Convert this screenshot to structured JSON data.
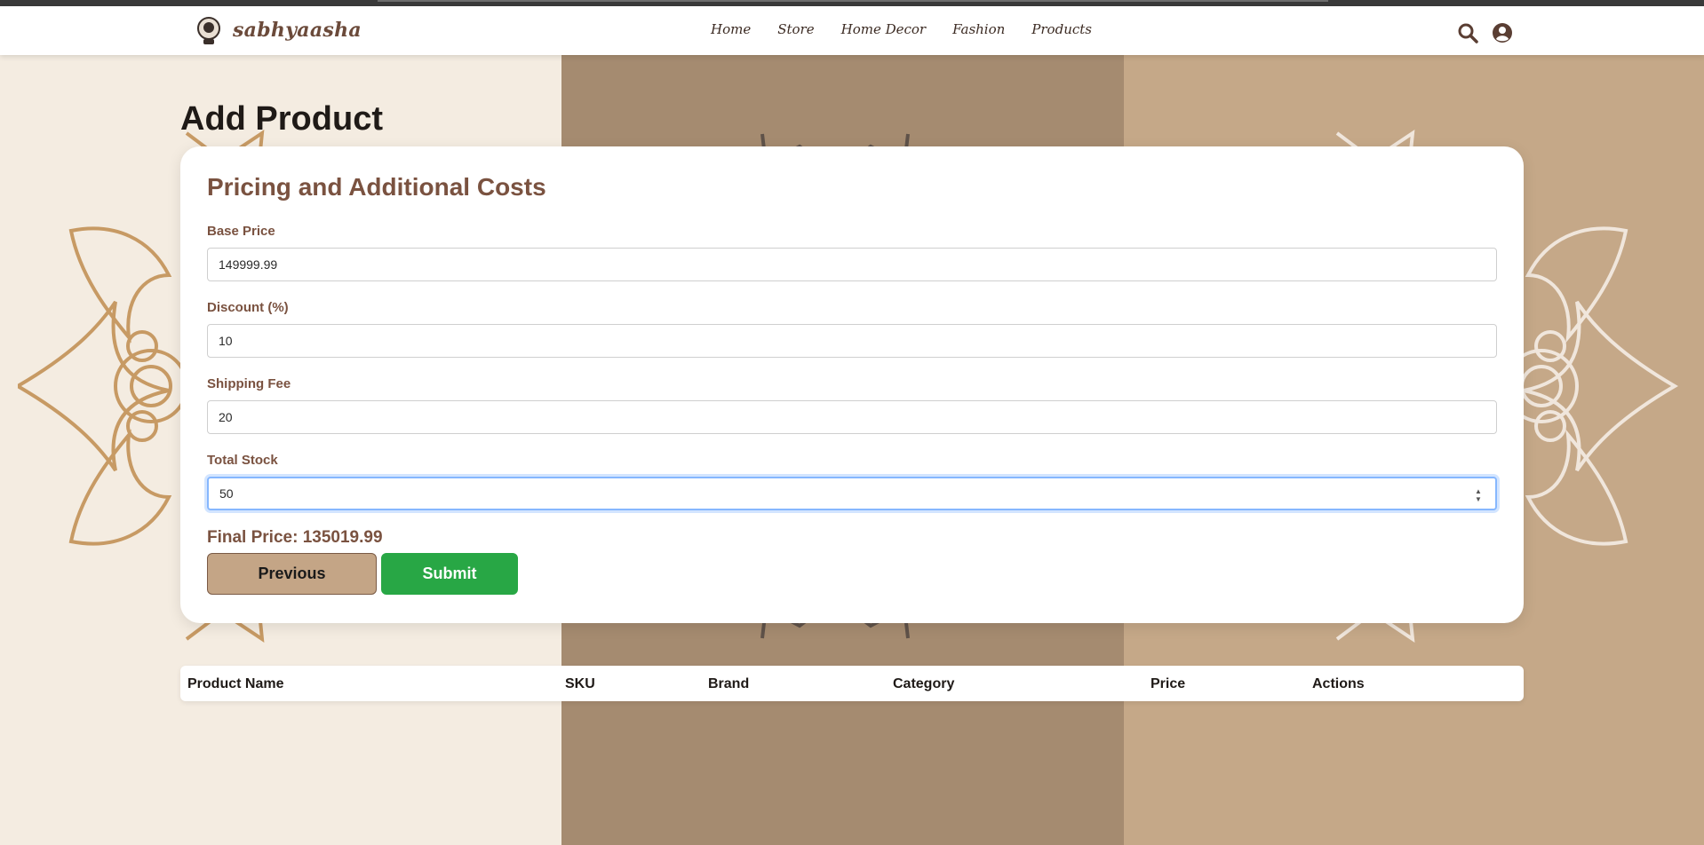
{
  "header": {
    "brand": "sabhyaasha",
    "nav": [
      "Home",
      "Store",
      "Home Decor",
      "Fashion",
      "Products"
    ],
    "icons": [
      "search-icon",
      "user-circle-icon"
    ]
  },
  "page": {
    "title": "Add Product"
  },
  "form": {
    "section_title": "Pricing and Additional Costs",
    "base_price": {
      "label": "Base Price",
      "value": "149999.99"
    },
    "discount": {
      "label": "Discount (%)",
      "value": "10"
    },
    "shipping_fee": {
      "label": "Shipping Fee",
      "value": "20"
    },
    "total_stock": {
      "label": "Total Stock",
      "value": "50"
    },
    "final_price_label": "Final Price: 135019.99",
    "previous_label": "Previous",
    "submit_label": "Submit"
  },
  "table": {
    "columns": [
      "Product Name",
      "SKU",
      "Brand",
      "Category",
      "Price",
      "Actions"
    ]
  },
  "colors": {
    "brand_brown": "#7a5240",
    "submit_green": "#28a745",
    "previous_tan": "#c4a586",
    "bg_cream": "#f4ece1",
    "bg_mid": "#a58b70",
    "bg_right": "#c5a888"
  }
}
